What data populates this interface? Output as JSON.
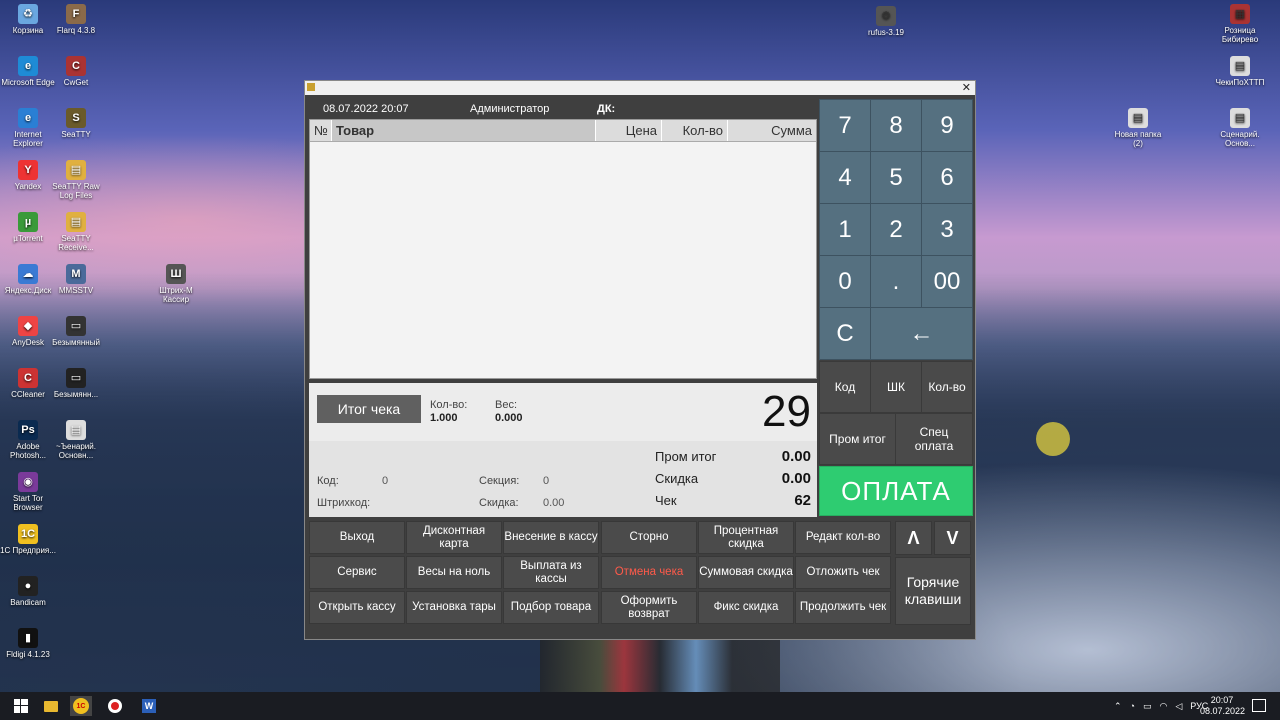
{
  "desktop_icons_left": [
    {
      "label": "Корзина",
      "icon": "recycle-bin-icon",
      "color": "#6aa7e0",
      "glyph": "♻"
    },
    {
      "label": "Flarq 4.3.8",
      "icon": "flarq-icon",
      "color": "#8a6a4a",
      "glyph": "F"
    },
    {
      "label": "Microsoft Edge",
      "icon": "edge-icon",
      "color": "#1e8bd6",
      "glyph": "e"
    },
    {
      "label": "CwGet",
      "icon": "cwget-icon",
      "color": "#a33",
      "glyph": "C"
    },
    {
      "label": "Internet Explorer",
      "icon": "ie-icon",
      "color": "#2a7fd4",
      "glyph": "e"
    },
    {
      "label": "SeaTTY",
      "icon": "seatty-icon",
      "color": "#6a5a2a",
      "glyph": "S"
    },
    {
      "label": "Yandex",
      "icon": "yandex-icon",
      "color": "#e33",
      "glyph": "Y"
    },
    {
      "label": "SeaTTY Raw Log Files",
      "icon": "folder-icon",
      "color": "#e0b040",
      "glyph": "▤"
    },
    {
      "label": "µTorrent",
      "icon": "utorrent-icon",
      "color": "#3a9a3a",
      "glyph": "µ"
    },
    {
      "label": "SeaTTY Receive...",
      "icon": "folder-icon",
      "color": "#e0b040",
      "glyph": "▤"
    },
    {
      "label": "Яндекс.Диск",
      "icon": "yandex-disk-icon",
      "color": "#3a7ad4",
      "glyph": "☁"
    },
    {
      "label": "MMSSTV",
      "icon": "mmsstv-icon",
      "color": "#4a6a9a",
      "glyph": "M"
    },
    {
      "label": "Штрих-М Кассир",
      "icon": "shtrih-icon",
      "color": "#555",
      "glyph": "Ш"
    },
    {
      "label": "AnyDesk",
      "icon": "anydesk-icon",
      "color": "#e44",
      "glyph": "◆"
    },
    {
      "label": "Безымянный",
      "icon": "file-icon",
      "color": "#333",
      "glyph": "▭"
    },
    {
      "label": "CCleaner",
      "icon": "ccleaner-icon",
      "color": "#c33",
      "glyph": "C"
    },
    {
      "label": "Безымянн...",
      "icon": "file-icon",
      "color": "#222",
      "glyph": "▭"
    },
    {
      "label": "Adobe Photosh...",
      "icon": "photoshop-icon",
      "color": "#0a2a50",
      "glyph": "Ps"
    },
    {
      "label": "~Ъенарий. Основн...",
      "icon": "doc-icon",
      "color": "#ddd",
      "glyph": "▤"
    },
    {
      "label": "Start Tor Browser",
      "icon": "tor-icon",
      "color": "#7a3a9a",
      "glyph": "◉"
    },
    {
      "label": "1С Предприя...",
      "icon": "1c-icon",
      "color": "#f0c020",
      "glyph": "1С"
    },
    {
      "label": "Bandicam",
      "icon": "bandicam-icon",
      "color": "#222",
      "glyph": "●"
    },
    {
      "label": "Fldigi 4.1.23",
      "icon": "fldigi-icon",
      "color": "#111",
      "glyph": "▮"
    }
  ],
  "desktop_icons_right": [
    {
      "label": "rufus-3.19",
      "icon": "rufus-icon",
      "color": "#555",
      "glyph": "⚙"
    },
    {
      "label": "Розница Бибирево",
      "icon": "archive-icon",
      "color": "#a33",
      "glyph": "▦"
    },
    {
      "label": "ЧекиПоХТТП",
      "icon": "file-icon",
      "color": "#ddd",
      "glyph": "▤"
    },
    {
      "label": "Новая папка (2)",
      "icon": "folder-icon",
      "color": "#ddd",
      "glyph": "▤"
    },
    {
      "label": "Сценарий. Основ...",
      "icon": "doc-icon",
      "color": "#ddd",
      "glyph": "▤"
    }
  ],
  "pos": {
    "datetime": "08.07.2022 20:07",
    "user": "Администратор",
    "dk_label": "ДК:",
    "columns": {
      "no": "№",
      "name": "Товар",
      "price": "Цена",
      "qty": "Кол-во",
      "sum": "Сумма"
    },
    "itog_button": "Итог чека",
    "qty_label": "Кол-во:",
    "qty_value": "1.000",
    "weight_label": "Вес:",
    "weight_value": "0.000",
    "big_number": "29",
    "code_label": "Код:",
    "code_value": "0",
    "barcode_label": "Штрихкод:",
    "section_label": "Секция:",
    "section_value": "0",
    "discount_label_left": "Скидка:",
    "discount_value_left": "0.00",
    "subtotal_label": "Пром итог",
    "subtotal_value": "0.00",
    "discount_label": "Скидка",
    "discount_value": "0.00",
    "check_label": "Чек",
    "check_value": "62"
  },
  "keypad": {
    "k7": "7",
    "k8": "8",
    "k9": "9",
    "k4": "4",
    "k5": "5",
    "k6": "6",
    "k1": "1",
    "k2": "2",
    "k3": "3",
    "k0": "0",
    "kdot": ".",
    "k00": "00",
    "clear": "C",
    "backspace": "←",
    "code": "Код",
    "barcode": "ШК",
    "qty": "Кол-во",
    "subtotal": "Пром итог",
    "special_pay": "Спец оплата",
    "pay": "ОПЛАТА"
  },
  "buttons": {
    "exit": "Выход",
    "discount_card": "Дисконтная карта",
    "cash_in": "Внесение в кассу",
    "storno": "Сторно",
    "percent_discount": "Процентная скидка",
    "edit_qty": "Редакт кол-во",
    "service": "Сервис",
    "scale_zero": "Весы на ноль",
    "cash_out": "Выплата из кассы",
    "cancel_check": "Отмена чека",
    "sum_discount": "Суммовая скидка",
    "postpone_check": "Отложить чек",
    "open_register": "Открыть кассу",
    "set_tare": "Установка тары",
    "product_select": "Подбор товара",
    "make_return": "Оформить возврат",
    "fixed_discount": "Фикс скидка",
    "continue_check": "Продолжить чек",
    "up": "Λ",
    "down": "V",
    "hotkeys": "Горячие клавиши"
  },
  "taskbar": {
    "lang": "РУС",
    "time": "20:07",
    "date": "08.07.2022"
  }
}
